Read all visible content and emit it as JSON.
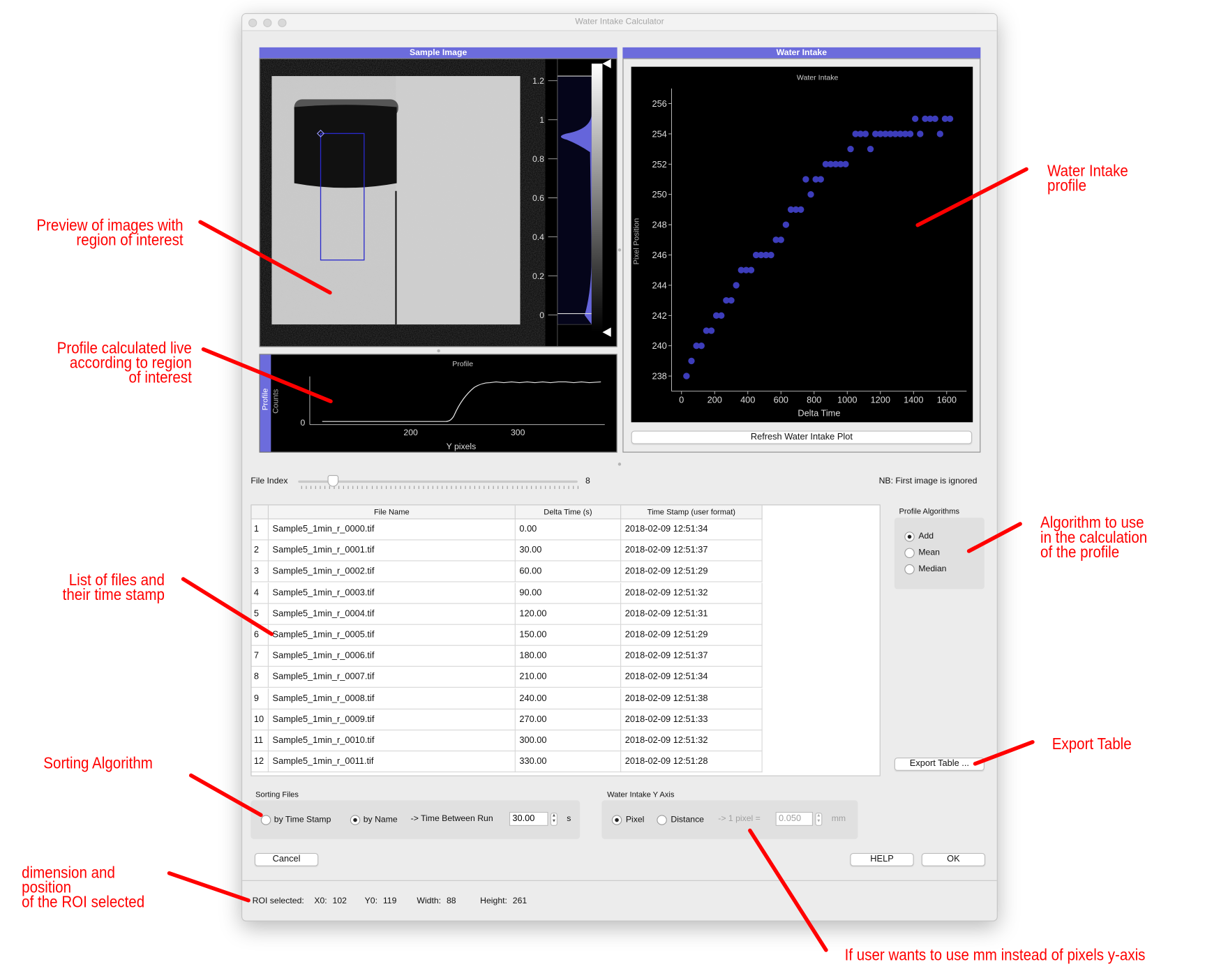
{
  "window": {
    "title": "Water Intake Calculator"
  },
  "sample_panel": {
    "title": "Sample Image",
    "hist_ticks": [
      "1.2",
      "1",
      "0.8",
      "0.6",
      "0.4",
      "0.2",
      "0"
    ]
  },
  "profile_panel": {
    "tab": "Profile",
    "title": "Profile",
    "ylabel": "Counts",
    "xlabel": "Y pixels",
    "xticks": [
      "200",
      "300"
    ],
    "yticks": [
      "0"
    ]
  },
  "water_panel": {
    "title": "Water Intake",
    "refresh_label": "Refresh Water Intake Plot"
  },
  "chart_data": {
    "type": "scatter",
    "title": "Water Intake",
    "xlabel": "Delta Time",
    "ylabel": "Pixel Position",
    "xlim": [
      -60,
      1720
    ],
    "ylim": [
      237,
      257
    ],
    "xticks": [
      "0",
      "200",
      "400",
      "600",
      "800",
      "1000",
      "1200",
      "1400",
      "1600"
    ],
    "yticks": [
      "238",
      "240",
      "242",
      "244",
      "246",
      "248",
      "250",
      "252",
      "254",
      "256"
    ],
    "color": "#3d3dbb",
    "points": [
      [
        30,
        238
      ],
      [
        60,
        239
      ],
      [
        90,
        240
      ],
      [
        120,
        240
      ],
      [
        150,
        241
      ],
      [
        180,
        241
      ],
      [
        210,
        242
      ],
      [
        240,
        242
      ],
      [
        270,
        243
      ],
      [
        300,
        243
      ],
      [
        330,
        244
      ],
      [
        360,
        245
      ],
      [
        390,
        245
      ],
      [
        420,
        245
      ],
      [
        450,
        246
      ],
      [
        480,
        246
      ],
      [
        510,
        246
      ],
      [
        540,
        246
      ],
      [
        570,
        247
      ],
      [
        600,
        247
      ],
      [
        630,
        248
      ],
      [
        660,
        249
      ],
      [
        690,
        249
      ],
      [
        720,
        249
      ],
      [
        750,
        251
      ],
      [
        780,
        250
      ],
      [
        810,
        251
      ],
      [
        840,
        251
      ],
      [
        870,
        252
      ],
      [
        900,
        252
      ],
      [
        930,
        252
      ],
      [
        960,
        252
      ],
      [
        990,
        252
      ],
      [
        1020,
        253
      ],
      [
        1050,
        254
      ],
      [
        1080,
        254
      ],
      [
        1110,
        254
      ],
      [
        1140,
        253
      ],
      [
        1170,
        254
      ],
      [
        1200,
        254
      ],
      [
        1230,
        254
      ],
      [
        1260,
        254
      ],
      [
        1290,
        254
      ],
      [
        1320,
        254
      ],
      [
        1350,
        254
      ],
      [
        1380,
        254
      ],
      [
        1410,
        255
      ],
      [
        1440,
        254
      ],
      [
        1470,
        255
      ],
      [
        1500,
        255
      ],
      [
        1530,
        255
      ],
      [
        1560,
        254
      ],
      [
        1590,
        255
      ],
      [
        1620,
        255
      ]
    ]
  },
  "file_index": {
    "label": "File Index",
    "value": "8",
    "note": "NB: First image is ignored",
    "fraction": 0.08
  },
  "table": {
    "headers": [
      "File Name",
      "Delta Time (s)",
      "Time Stamp (user format)"
    ],
    "rows": [
      {
        "n": "1",
        "name": "Sample5_1min_r_0000.tif",
        "dt": "0.00",
        "ts": "2018-02-09 12:51:34"
      },
      {
        "n": "2",
        "name": "Sample5_1min_r_0001.tif",
        "dt": "30.00",
        "ts": "2018-02-09 12:51:37"
      },
      {
        "n": "3",
        "name": "Sample5_1min_r_0002.tif",
        "dt": "60.00",
        "ts": "2018-02-09 12:51:29"
      },
      {
        "n": "4",
        "name": "Sample5_1min_r_0003.tif",
        "dt": "90.00",
        "ts": "2018-02-09 12:51:32"
      },
      {
        "n": "5",
        "name": "Sample5_1min_r_0004.tif",
        "dt": "120.00",
        "ts": "2018-02-09 12:51:31"
      },
      {
        "n": "6",
        "name": "Sample5_1min_r_0005.tif",
        "dt": "150.00",
        "ts": "2018-02-09 12:51:29"
      },
      {
        "n": "7",
        "name": "Sample5_1min_r_0006.tif",
        "dt": "180.00",
        "ts": "2018-02-09 12:51:37"
      },
      {
        "n": "8",
        "name": "Sample5_1min_r_0007.tif",
        "dt": "210.00",
        "ts": "2018-02-09 12:51:34"
      },
      {
        "n": "9",
        "name": "Sample5_1min_r_0008.tif",
        "dt": "240.00",
        "ts": "2018-02-09 12:51:38"
      },
      {
        "n": "10",
        "name": "Sample5_1min_r_0009.tif",
        "dt": "270.00",
        "ts": "2018-02-09 12:51:33"
      },
      {
        "n": "11",
        "name": "Sample5_1min_r_0010.tif",
        "dt": "300.00",
        "ts": "2018-02-09 12:51:32"
      },
      {
        "n": "12",
        "name": "Sample5_1min_r_0011.tif",
        "dt": "330.00",
        "ts": "2018-02-09 12:51:28"
      }
    ]
  },
  "profile_algorithms": {
    "title": "Profile Algorithms",
    "options": [
      "Add",
      "Mean",
      "Median"
    ],
    "selected": "Add"
  },
  "export_label": "Export Table ...",
  "sorting": {
    "title": "Sorting Files",
    "by_time": "by Time Stamp",
    "by_name": "by Name",
    "between_label": "-> Time Between Run",
    "between_value": "30.00",
    "unit": "s"
  },
  "y_axis": {
    "title": "Water Intake Y Axis",
    "pixel": "Pixel",
    "distance": "Distance",
    "conv_label": "-> 1 pixel =",
    "conv_value": "0.050",
    "unit": "mm"
  },
  "buttons": {
    "cancel": "Cancel",
    "help": "HELP",
    "ok": "OK"
  },
  "roi": {
    "label": "ROI selected:",
    "x0_label": "X0:",
    "x0": "102",
    "y0_label": "Y0:",
    "y0": "119",
    "width_label": "Width:",
    "width": "88",
    "height_label": "Height:",
    "height": "261"
  },
  "annotations": {
    "preview": [
      "Preview of images with",
      "region of interest"
    ],
    "profile": [
      "Profile calculated live",
      "according to region",
      "of interest"
    ],
    "files": [
      "List of files and",
      "their time stamp"
    ],
    "sorting": [
      "Sorting Algorithm"
    ],
    "roi": [
      "dimension and",
      "position",
      "of the ROI selected"
    ],
    "water": [
      "Water Intake",
      "profile"
    ],
    "algorithm": [
      "Algorithm to use",
      "in the calculation",
      "of the profile"
    ],
    "export": [
      "Export Table"
    ],
    "mm": [
      "If user wants to use mm instead of pixels y-axis"
    ]
  },
  "colors": {
    "accent": "#6c6cdc",
    "annotation": "#ff0000",
    "points": "#3d3dbb"
  }
}
